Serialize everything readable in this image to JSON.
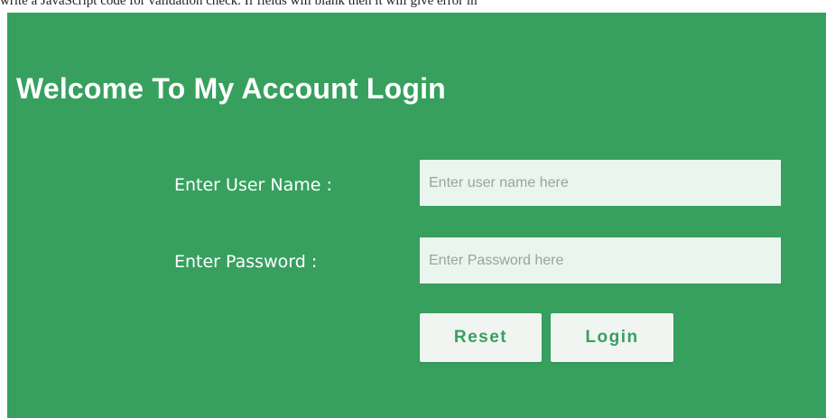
{
  "top_strip": {
    "text": "write a JavaScript code for validation check. If fields will blank then it will give error in"
  },
  "login": {
    "title": "Welcome To My Account Login",
    "username_label": "Enter User Name :",
    "username_placeholder": "Enter user name here",
    "username_value": "",
    "password_label": "Enter Password :",
    "password_placeholder": "Enter Password here",
    "password_value": "",
    "reset_label": "Reset",
    "login_label": "Login"
  },
  "colors": {
    "panel_background": "#37a05f",
    "input_background": "#ebf5ef",
    "button_background": "#f1f5f2",
    "button_text": "#37a05f",
    "label_text": "#ffffff"
  }
}
